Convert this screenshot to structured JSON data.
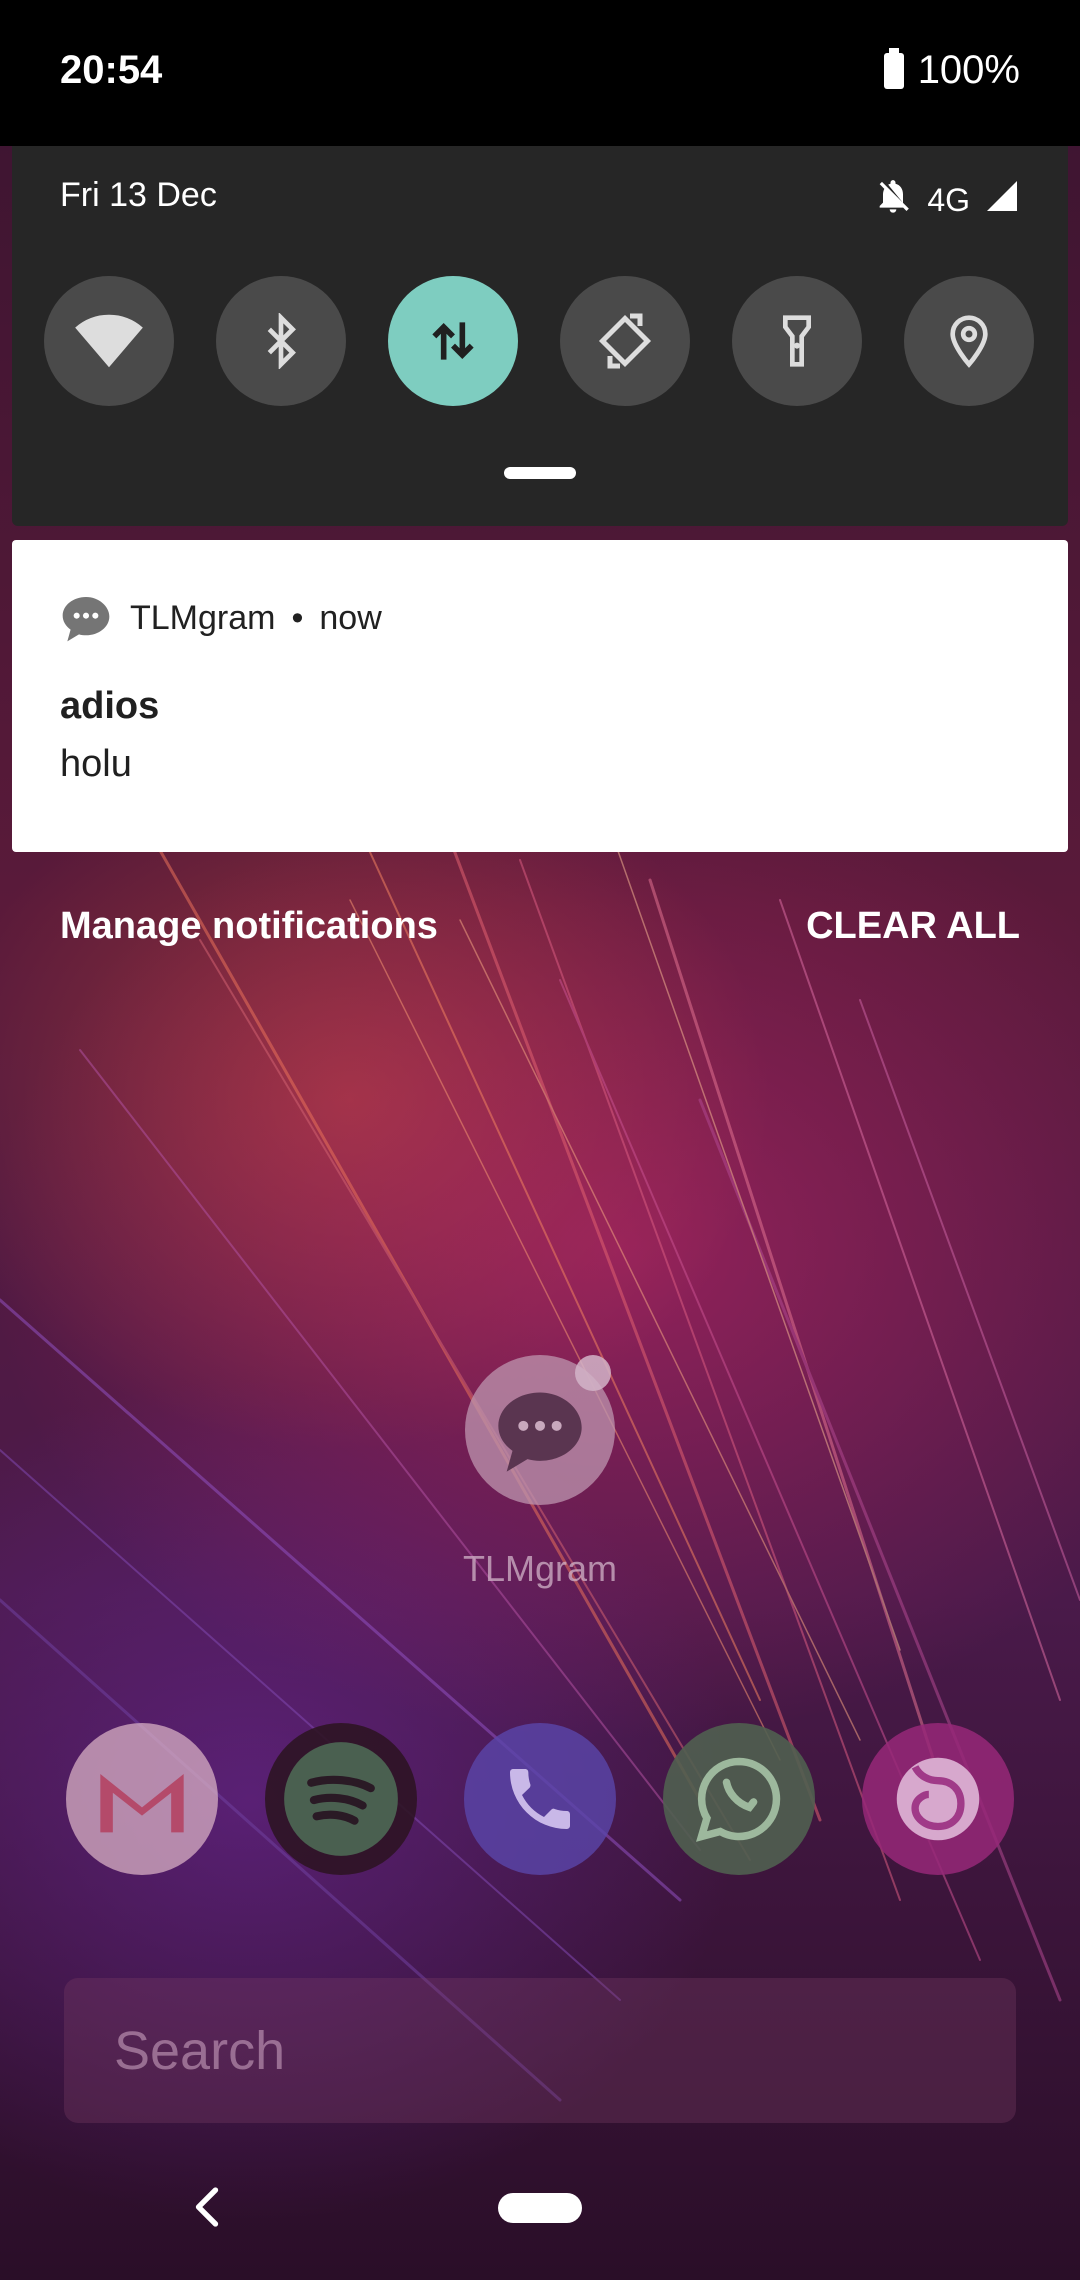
{
  "status_bar": {
    "time": "20:54",
    "battery": "100%"
  },
  "quick_settings": {
    "date": "Fri 13 Dec",
    "network": "4G",
    "tiles": [
      {
        "name": "wifi",
        "icon": "wifi-icon",
        "active": false
      },
      {
        "name": "bluetooth",
        "icon": "bluetooth-icon",
        "active": false
      },
      {
        "name": "mobile-data",
        "icon": "data-arrows-icon",
        "active": true
      },
      {
        "name": "auto-rotate",
        "icon": "rotate-icon",
        "active": false
      },
      {
        "name": "flashlight",
        "icon": "flashlight-icon",
        "active": false
      },
      {
        "name": "location",
        "icon": "location-icon",
        "active": false
      }
    ],
    "accent_color": "#7ecdc0"
  },
  "notification": {
    "app": "TLMgram",
    "time": "now",
    "title": "adios",
    "text": "holu"
  },
  "actions": {
    "manage": "Manage notifications",
    "clear_all": "CLEAR ALL"
  },
  "home": {
    "app_label": "TLMgram",
    "dock": [
      {
        "name": "gmail",
        "icon": "gmail-icon"
      },
      {
        "name": "spotify",
        "icon": "spotify-icon"
      },
      {
        "name": "phone",
        "icon": "phone-icon"
      },
      {
        "name": "whatsapp",
        "icon": "whatsapp-icon"
      },
      {
        "name": "firefox",
        "icon": "firefox-icon"
      }
    ],
    "search_placeholder": "Search"
  }
}
